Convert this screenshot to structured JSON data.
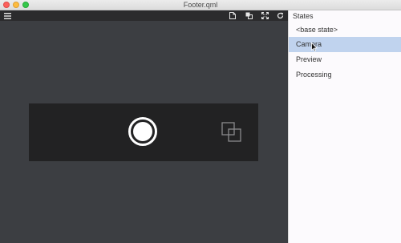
{
  "window": {
    "title": "Footer.qml"
  },
  "toolbar": {
    "icons": [
      "menu-icon",
      "new-file-icon",
      "copy-icon",
      "fit-screen-icon",
      "refresh-icon"
    ]
  },
  "states": {
    "header": "States",
    "items": [
      {
        "label": "<base state>",
        "selected": false
      },
      {
        "label": "Camera",
        "selected": true
      },
      {
        "label": "Preview",
        "selected": false
      },
      {
        "label": "Processing",
        "selected": false
      }
    ]
  },
  "colors": {
    "canvas_bg": "#3c3e42",
    "toolbar_bg": "#2b2b2d",
    "footer_bg": "#222223",
    "selected_state": "#c0d3ee",
    "panel_bg": "#fcfafd"
  }
}
